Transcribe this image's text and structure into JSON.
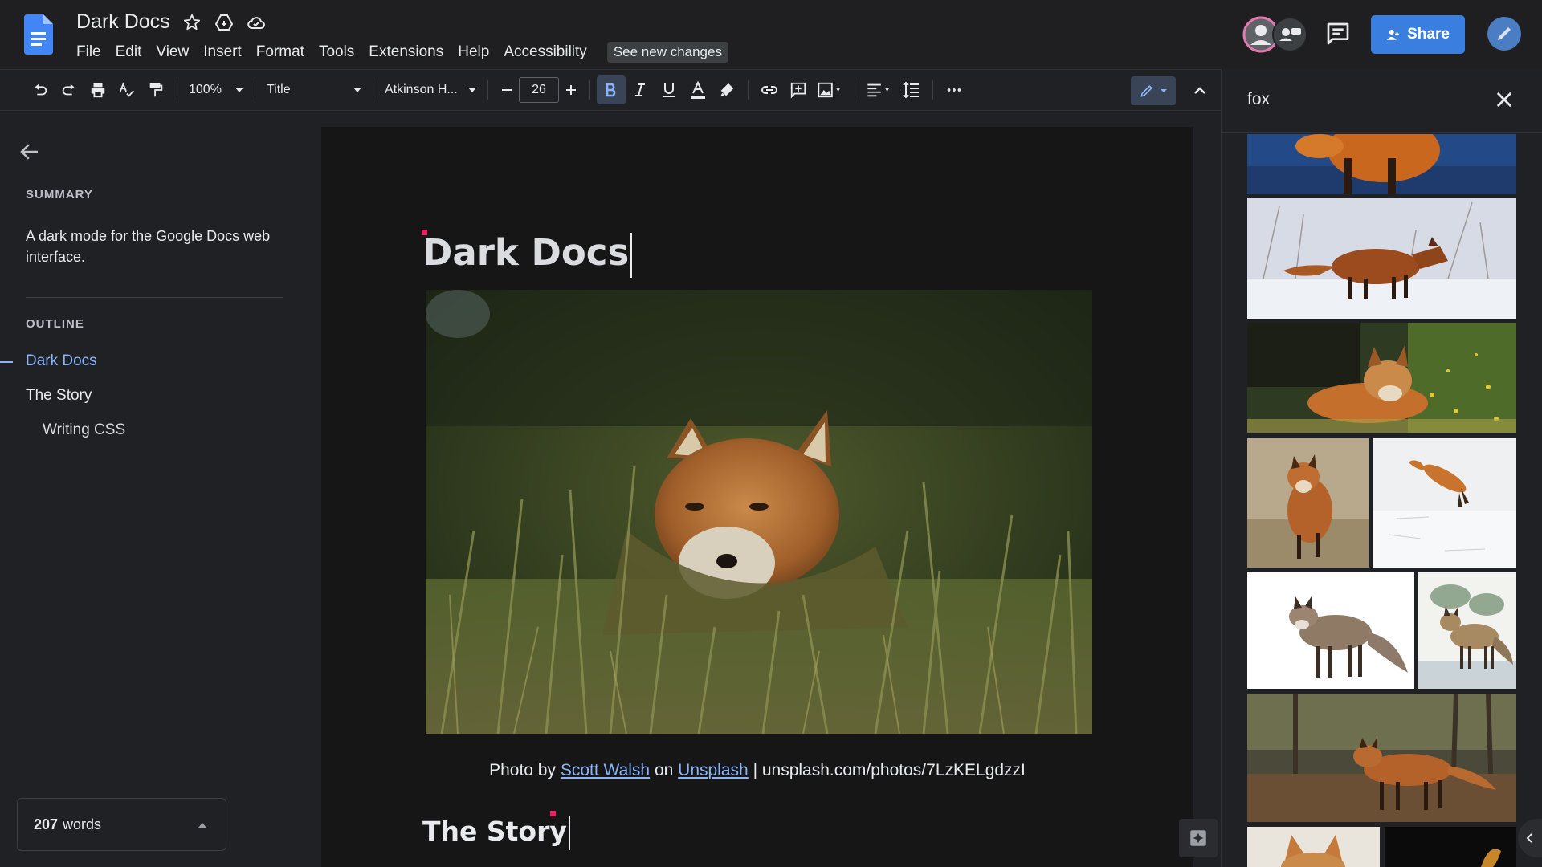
{
  "header": {
    "doc_title": "Dark Docs",
    "menu": [
      "File",
      "Edit",
      "View",
      "Insert",
      "Format",
      "Tools",
      "Extensions",
      "Help",
      "Accessibility"
    ],
    "new_changes": "See new changes",
    "share_label": "Share"
  },
  "toolbar": {
    "zoom": "100%",
    "style": "Title",
    "font": "Atkinson H...",
    "font_size": "26"
  },
  "sidebar": {
    "summary_label": "SUMMARY",
    "summary_text": "A dark mode for the Google Docs web interface.",
    "outline_label": "OUTLINE",
    "outline": [
      {
        "label": "Dark Docs"
      },
      {
        "label": "The Story"
      },
      {
        "label": "Writing CSS"
      }
    ],
    "word_count_number": "207",
    "word_count_unit": "words"
  },
  "document": {
    "title": "Dark Docs",
    "caption_prefix": "Photo by",
    "caption_author": "Scott Walsh",
    "caption_on": "on",
    "caption_site": "Unsplash",
    "caption_suffix": "| unsplash.com/photos/7LzKELgdzzI",
    "heading_2": "The Story"
  },
  "image_search": {
    "query": "fox"
  },
  "colors": {
    "accent": "#8ab4f8",
    "share_button": "#3a7fe0",
    "background": "#202124",
    "page": "#161616"
  }
}
